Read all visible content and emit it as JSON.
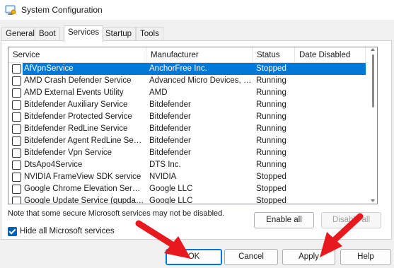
{
  "window": {
    "title": "System Configuration"
  },
  "tabs": [
    {
      "label": "General"
    },
    {
      "label": "Boot"
    },
    {
      "label": "Services"
    },
    {
      "label": "Startup"
    },
    {
      "label": "Tools"
    }
  ],
  "active_tab": "Services",
  "table": {
    "headers": {
      "service": "Service",
      "manufacturer": "Manufacturer",
      "status": "Status",
      "date_disabled": "Date Disabled"
    },
    "rows": [
      {
        "service": "AfVpnService",
        "manufacturer": "AnchorFree Inc.",
        "status": "Stopped",
        "date": "",
        "checked": false,
        "selected": true
      },
      {
        "service": "AMD Crash Defender Service",
        "manufacturer": "Advanced Micro Devices, I...",
        "status": "Running",
        "date": "",
        "checked": false
      },
      {
        "service": "AMD External Events Utility",
        "manufacturer": "AMD",
        "status": "Running",
        "date": "",
        "checked": false
      },
      {
        "service": "Bitdefender Auxiliary Service",
        "manufacturer": "Bitdefender",
        "status": "Running",
        "date": "",
        "checked": false
      },
      {
        "service": "Bitdefender Protected Service",
        "manufacturer": "Bitdefender",
        "status": "Running",
        "date": "",
        "checked": false
      },
      {
        "service": "Bitdefender RedLine Service",
        "manufacturer": "Bitdefender",
        "status": "Running",
        "date": "",
        "checked": false
      },
      {
        "service": "Bitdefender Agent RedLine Service",
        "manufacturer": "Bitdefender",
        "status": "Running",
        "date": "",
        "checked": false
      },
      {
        "service": "Bitdefender Vpn Service",
        "manufacturer": "Bitdefender",
        "status": "Running",
        "date": "",
        "checked": false
      },
      {
        "service": "DtsApo4Service",
        "manufacturer": "DTS Inc.",
        "status": "Running",
        "date": "",
        "checked": false
      },
      {
        "service": "NVIDIA FrameView SDK service",
        "manufacturer": "NVIDIA",
        "status": "Stopped",
        "date": "",
        "checked": false
      },
      {
        "service": "Google Chrome Elevation Servic...",
        "manufacturer": "Google LLC",
        "status": "Stopped",
        "date": "",
        "checked": false
      },
      {
        "service": "Google Update Service (gupdate)",
        "manufacturer": "Google LLC",
        "status": "Stopped",
        "date": "",
        "checked": false
      }
    ]
  },
  "note": "Note that some secure Microsoft services may not be disabled.",
  "buttons": {
    "enable_all": "Enable all",
    "disable_all": "Disable all",
    "ok": "OK",
    "cancel": "Cancel",
    "apply": "Apply",
    "help": "Help"
  },
  "hide_ms": {
    "label": "Hide all Microsoft services",
    "checked": true
  },
  "colors": {
    "selection": "#0078d7",
    "arrow": "#e8191e",
    "checkbox_checked": "#005fb8"
  },
  "icons": {
    "app": "msconfig-icon"
  }
}
